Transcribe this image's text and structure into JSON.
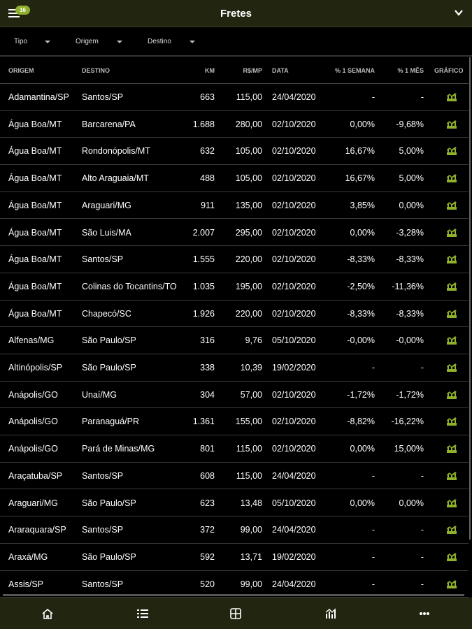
{
  "header": {
    "title": "Fretes",
    "badge": "16"
  },
  "filters": [
    "Tipo",
    "Origem",
    "Destino"
  ],
  "columns": [
    "ORIGEM",
    "DESTINO",
    "KM",
    "R$/MP",
    "DATA",
    "% 1 SEMANA",
    "% 1 MÊS",
    "GRÁFICO"
  ],
  "accent": "#8fb02b",
  "rows": [
    [
      "Adamantina/SP",
      "Santos/SP",
      "663",
      "115,00",
      "24/04/2020",
      "-",
      "-"
    ],
    [
      "Água Boa/MT",
      "Barcarena/PA",
      "1.688",
      "280,00",
      "02/10/2020",
      "0,00%",
      "-9,68%"
    ],
    [
      "Água Boa/MT",
      "Rondonópolis/MT",
      "632",
      "105,00",
      "02/10/2020",
      "16,67%",
      "5,00%"
    ],
    [
      "Água Boa/MT",
      "Alto Araguaia/MT",
      "488",
      "105,00",
      "02/10/2020",
      "16,67%",
      "5,00%"
    ],
    [
      "Água Boa/MT",
      "Araguari/MG",
      "911",
      "135,00",
      "02/10/2020",
      "3,85%",
      "0,00%"
    ],
    [
      "Água Boa/MT",
      "São Luis/MA",
      "2.007",
      "295,00",
      "02/10/2020",
      "0,00%",
      "-3,28%"
    ],
    [
      "Água Boa/MT",
      "Santos/SP",
      "1.555",
      "220,00",
      "02/10/2020",
      "-8,33%",
      "-8,33%"
    ],
    [
      "Água Boa/MT",
      "Colinas do Tocantins/TO",
      "1.035",
      "195,00",
      "02/10/2020",
      "-2,50%",
      "-11,36%"
    ],
    [
      "Água Boa/MT",
      "Chapecó/SC",
      "1.926",
      "220,00",
      "02/10/2020",
      "-8,33%",
      "-8,33%"
    ],
    [
      "Alfenas/MG",
      "São Paulo/SP",
      "316",
      "9,76",
      "05/10/2020",
      "-0,00%",
      "-0,00%"
    ],
    [
      "Altinópolis/SP",
      "São Paulo/SP",
      "338",
      "10,39",
      "19/02/2020",
      "-",
      "-"
    ],
    [
      "Anápolis/GO",
      "Unaí/MG",
      "304",
      "57,00",
      "02/10/2020",
      "-1,72%",
      "-1,72%"
    ],
    [
      "Anápolis/GO",
      "Paranaguá/PR",
      "1.361",
      "155,00",
      "02/10/2020",
      "-8,82%",
      "-16,22%"
    ],
    [
      "Anápolis/GO",
      "Pará de Minas/MG",
      "801",
      "115,00",
      "02/10/2020",
      "0,00%",
      "15,00%"
    ],
    [
      "Araçatuba/SP",
      "Santos/SP",
      "608",
      "115,00",
      "24/04/2020",
      "-",
      "-"
    ],
    [
      "Araguari/MG",
      "São Paulo/SP",
      "623",
      "13,48",
      "05/10/2020",
      "0,00%",
      "0,00%"
    ],
    [
      "Araraquara/SP",
      "Santos/SP",
      "372",
      "99,00",
      "24/04/2020",
      "-",
      "-"
    ],
    [
      "Araxá/MG",
      "São Paulo/SP",
      "592",
      "13,71",
      "19/02/2020",
      "-",
      "-"
    ],
    [
      "Assis/SP",
      "Santos/SP",
      "520",
      "99,00",
      "24/04/2020",
      "-",
      "-"
    ]
  ]
}
